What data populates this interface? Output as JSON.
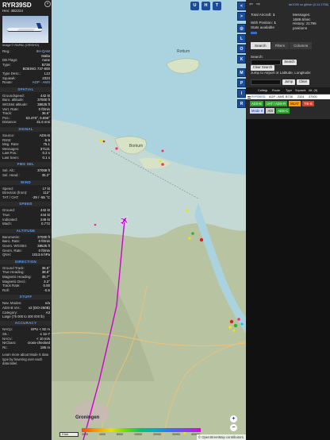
{
  "aircraft_panel": {
    "callsign": "RYR39SD",
    "hex_label": "Hex:",
    "hex": "4B2224",
    "photo_credit": "Image © RAPAL (ORISHO)",
    "details": [
      {
        "k": "Reg.:",
        "v": "9H-QAM",
        "link": true
      },
      {
        "k": "",
        "v": "Malta"
      },
      {
        "k": "DB Flags:",
        "v": "none"
      },
      {
        "k": "Type:",
        "v": "B738"
      },
      {
        "k": "",
        "v": "BOEING 737-800"
      },
      {
        "k": "Type Desc.:",
        "v": "L2J"
      },
      {
        "k": "Squawk:",
        "v": "2324"
      },
      {
        "k": "Route:",
        "v": "AGP - AMS",
        "link": true
      }
    ],
    "spatial_header": "SPATIAL",
    "spatial": [
      {
        "k": "Groundspeed:",
        "v": "442 kt"
      },
      {
        "k": "Baro. altitude:",
        "v": "37000 ft"
      },
      {
        "k": "WGS84 altitude:",
        "v": "38625 ft"
      },
      {
        "k": "Vert. Rate:",
        "v": "0 ft/min"
      },
      {
        "k": "Track:",
        "v": "36.6°"
      },
      {
        "k": "Pos.:",
        "v": "53.476°, 6.655°"
      },
      {
        "k": "Distance:",
        "v": "31.6 nmi"
      }
    ],
    "signal_header": "SIGNAL",
    "signal": [
      {
        "k": "Source:",
        "v": "ADS-B"
      },
      {
        "k": "RSSI:",
        "v": "-5.9"
      },
      {
        "k": "Msg. Rate:",
        "v": "75.1"
      },
      {
        "k": "Messages:",
        "v": "37121"
      },
      {
        "k": "Last Pos.:",
        "v": "0.2 s"
      },
      {
        "k": "Last Seen:",
        "v": "0.1 s"
      }
    ],
    "fms_header": "FMS SEL",
    "fms": [
      {
        "k": "Sel. Alt.:",
        "v": "37008 ft"
      },
      {
        "k": "Sel. Head.:",
        "v": "35.2°"
      }
    ],
    "wind_header": "WIND",
    "wind": [
      {
        "k": "Speed:",
        "v": "17 kt"
      },
      {
        "k": "Direction (from):",
        "v": "112°"
      },
      {
        "k": "TAT / OAT:",
        "v": "-29 / -55 °C"
      }
    ],
    "speed_header": "SPEED",
    "speed": [
      {
        "k": "Ground:",
        "v": "442 kt"
      },
      {
        "k": "True:",
        "v": "444 kt"
      },
      {
        "k": "Indicated:",
        "v": "249 kt"
      },
      {
        "k": "Mach:",
        "v": "0.772"
      }
    ],
    "altitude_header": "ALTITUDE",
    "altitude": [
      {
        "k": "Barometric:",
        "v": "37000 ft"
      },
      {
        "k": "Baro. Rate:",
        "v": "0 ft/min"
      },
      {
        "k": "Geom. WGS84:",
        "v": "38625 ft"
      },
      {
        "k": "Geom. Rate:",
        "v": "0 ft/min"
      },
      {
        "k": "QNH:",
        "v": "1013.6 hPa"
      }
    ],
    "direction_header": "DIRECTION",
    "direction": [
      {
        "k": "Ground Track:",
        "v": "36.6°"
      },
      {
        "k": "True Heading:",
        "v": "38.8°"
      },
      {
        "k": "Magnetic Heading:",
        "v": "35.7°"
      },
      {
        "k": "Magnetic Decl.:",
        "v": "3.2°"
      },
      {
        "k": "Track Rate:",
        "v": "0.00"
      },
      {
        "k": "Roll:",
        "v": "-0.5"
      }
    ],
    "stuff_header": "STUFF",
    "stuff": [
      {
        "k": "Nav. Modes:",
        "v": "n/a"
      },
      {
        "k": "ADS-B Ver.:",
        "v": "v2 (DO-260B)"
      },
      {
        "k": "Category:",
        "v": "A3"
      }
    ],
    "category_desc": "Large (75 000 to 300 000 lb)",
    "accuracy_header": "ACCURACY",
    "accuracy": [
      {
        "k": "NACp:",
        "v": "EPU < 92 m"
      },
      {
        "k": "SIL:",
        "v": "≤ 1e-7"
      },
      {
        "k": "NACv:",
        "v": "< 10 m/s"
      },
      {
        "k": "NICbaro:",
        "v": "cross-checked"
      },
      {
        "k": "Rc:",
        "v": "186 m"
      }
    ],
    "footer": "Learn more about Mode S data type by hovering over each data label."
  },
  "map": {
    "labels": [
      "Rottum",
      "Borkum",
      "Groningen"
    ],
    "top_buttons": [
      "U",
      "H",
      "T"
    ],
    "scale_label": "2 km",
    "alt_legend": [
      "2000",
      "4000",
      "8000",
      "10000",
      "20000",
      "30000",
      "40000+"
    ],
    "attribution": "© OpenStreetMap contributors.",
    "zoom_in": "+",
    "zoom_out": "−"
  },
  "toolbar": {
    "buttons": [
      "<",
      ">",
      "◎",
      "L",
      "O",
      "K",
      "M",
      "P",
      "I",
      "R"
    ]
  },
  "right_panel": {
    "version_link": "tar1090 on github (3.14.1758)",
    "stats": {
      "total_aircraft_label": "Total Aircraft:",
      "total_aircraft": "1",
      "messages_label": "Messages:",
      "messages": "1689.6/sec",
      "with_position_label": "With Position:",
      "with_position": "1",
      "history_label": "History:",
      "history": "21795 positions",
      "stats_available": "Stats available"
    },
    "tabs": [
      "Search",
      "Filters",
      "Columns"
    ],
    "search_label": "Search:",
    "search_button": "Search",
    "clear_search_button": "Clear Search",
    "jump_label": "Jump to Airport or Latitude, Longitude:",
    "jump_button": "Jump",
    "clear_button": "Clear",
    "table_headers": [
      "Callsign",
      "Route",
      "Type",
      "Squawk",
      "Alt. (ft)"
    ],
    "table_rows": [
      {
        "callsign": "RYR39SD",
        "route": "AGP - AMS",
        "type": "B738",
        "squawk": "2324",
        "alt": "37000"
      }
    ],
    "filter_chips": [
      "ADS-B",
      "UAT / ADS-R",
      "MLAT",
      "TIS-B",
      "Mode S",
      "AIS",
      "ADS-C"
    ]
  }
}
